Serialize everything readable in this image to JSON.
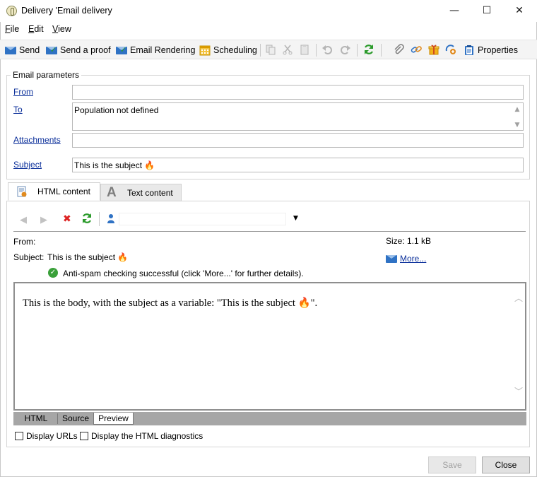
{
  "window": {
    "title": "Delivery 'Email delivery",
    "minimize": "—",
    "maximize": "☐",
    "close": "✕"
  },
  "menu": [
    "File",
    "Edit",
    "View"
  ],
  "menu_accel": [
    "F",
    "E",
    "V"
  ],
  "menu_rest": [
    "ile",
    "dit",
    "iew"
  ],
  "toolbar": {
    "send": "Send",
    "send_proof": "Send a proof",
    "email_rendering": "Email Rendering",
    "scheduling": "Scheduling",
    "properties": "Properties"
  },
  "params": {
    "legend": "Email parameters",
    "from_label": "From",
    "from_value": "",
    "to_label": "To",
    "to_value": "Population not defined",
    "attachments_label": "Attachments",
    "attachments_value": "",
    "subject_label": "Subject",
    "subject_value": "This is the subject 🔥"
  },
  "tabs": {
    "html": "HTML content",
    "text": "Text content"
  },
  "preview_info": {
    "from_label": "From:",
    "from_value": "",
    "subject_label": "Subject:",
    "subject_value": "This is the subject 🔥",
    "size_label": "Size:",
    "size_value": "1.1 kB",
    "more_label": "More...",
    "antispam": "Anti-spam checking successful (click 'More...' for further details)."
  },
  "preview_body": "This is the body, with the subject as a variable: \"This is the subject 🔥\".",
  "bottom_tabs": [
    "HTML",
    "Source",
    "Preview"
  ],
  "checkboxes": {
    "display_urls": "Display URLs",
    "html_diagnostics": "Display the HTML diagnostics"
  },
  "buttons": {
    "save": "Save",
    "close": "Close"
  },
  "colors": {
    "link_blue": "#0b2f9a",
    "accent_blue": "#2f72c4",
    "success_green": "#2a9a2a"
  }
}
